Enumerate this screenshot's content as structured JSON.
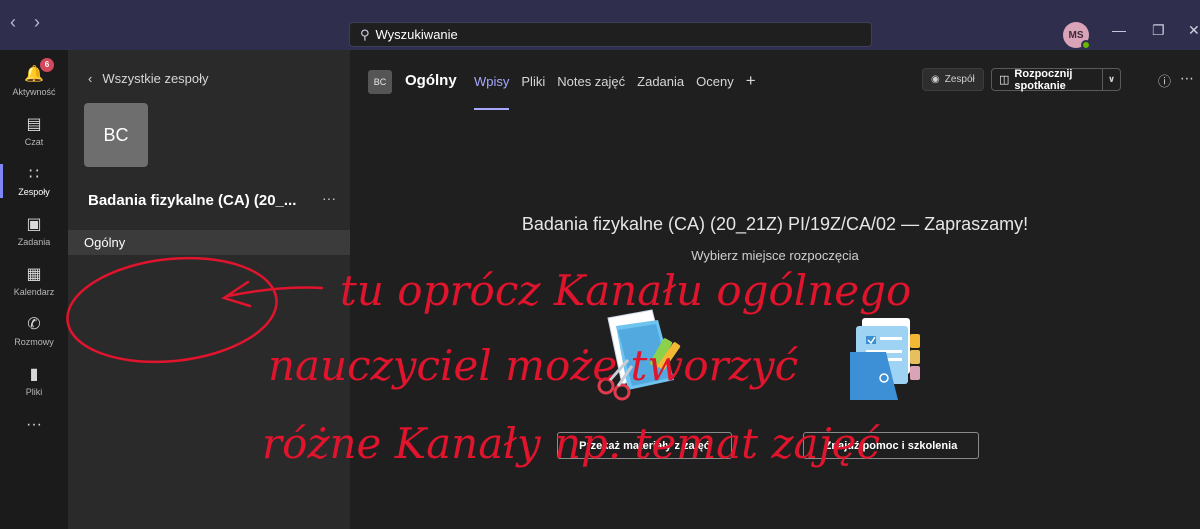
{
  "titlebar": {
    "search_placeholder": "Wyszukiwanie",
    "user_initials": "MS"
  },
  "rail": [
    {
      "label": "Aktywność",
      "badge": "6",
      "icon": "bell-icon"
    },
    {
      "label": "Czat",
      "icon": "chat-icon"
    },
    {
      "label": "Zespoły",
      "icon": "teams-icon"
    },
    {
      "label": "Zadania",
      "icon": "assignments-icon"
    },
    {
      "label": "Kalendarz",
      "icon": "calendar-icon"
    },
    {
      "label": "Rozmowy",
      "icon": "phone-icon"
    },
    {
      "label": "Pliki",
      "icon": "file-icon"
    },
    {
      "label": "···",
      "icon": "more-icon"
    }
  ],
  "team_panel": {
    "back_label": "Wszystkie zespoły",
    "team_initials": "BC",
    "team_name": "Badania fizykalne (CA) (20_...",
    "more": "···",
    "channel": "Ogólny"
  },
  "header": {
    "channel_initials": "BC",
    "channel_title": "Ogólny",
    "tabs": [
      "Wpisy",
      "Pliki",
      "Notes zajęć",
      "Zadania",
      "Oceny"
    ],
    "add_tab": "+",
    "team_button": "Zespół",
    "meet_button": "Rozpocznij spotkanie"
  },
  "welcome": {
    "title": "Badania fizykalne (CA) (20_21Z) PI/19Z/CA/02 — Zapraszamy!",
    "subtitle": "Wybierz miejsce rozpoczęcia",
    "button_upload": "Przekaż materiały z zajęć",
    "button_help": "Znajdź pomoc i szkolenia"
  },
  "annotation": {
    "line1": "tu oprócz Kanału ogólnego",
    "line2": "nauczyciel może tworzyć",
    "line3": "różne Kanały np. temat zajęć",
    "color": "#e0142c"
  }
}
